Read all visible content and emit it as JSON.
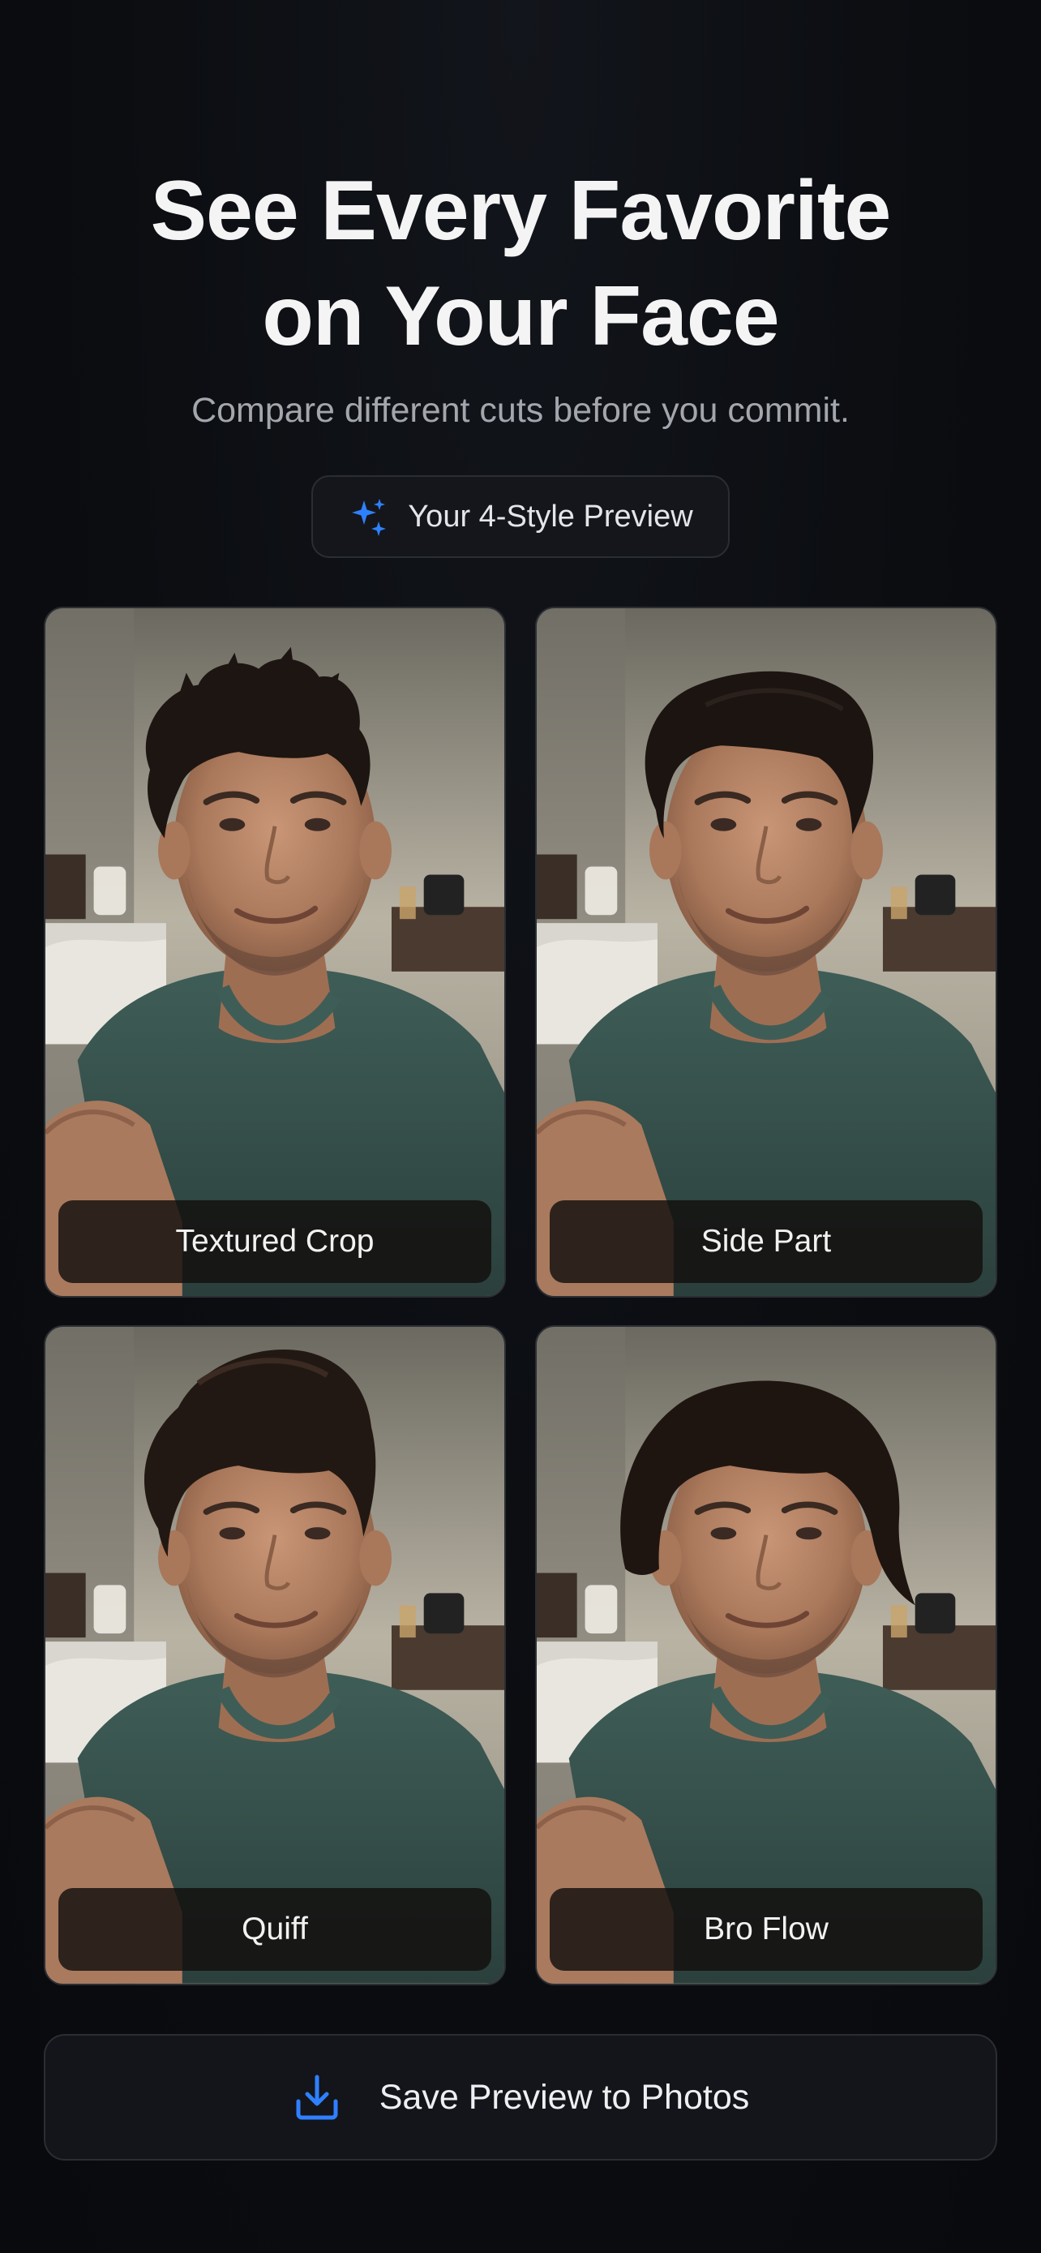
{
  "header": {
    "title_line1": "See Every Favorite",
    "title_line2": "on Your Face",
    "subtitle": "Compare different cuts before you commit."
  },
  "chip": {
    "icon": "sparkles-icon",
    "label": "Your 4-Style Preview"
  },
  "styles": [
    {
      "label": "Textured Crop",
      "hair": "textured-crop"
    },
    {
      "label": "Side Part",
      "hair": "side-part"
    },
    {
      "label": "Quiff",
      "hair": "quiff"
    },
    {
      "label": "Bro Flow",
      "hair": "bro-flow"
    }
  ],
  "save": {
    "icon": "download-icon",
    "label": "Save Preview to Photos"
  },
  "colors": {
    "background": "#0b0d11",
    "accent": "#2f80ff",
    "card_border": "#2b2e34",
    "label_overlay": "#120f0d"
  }
}
